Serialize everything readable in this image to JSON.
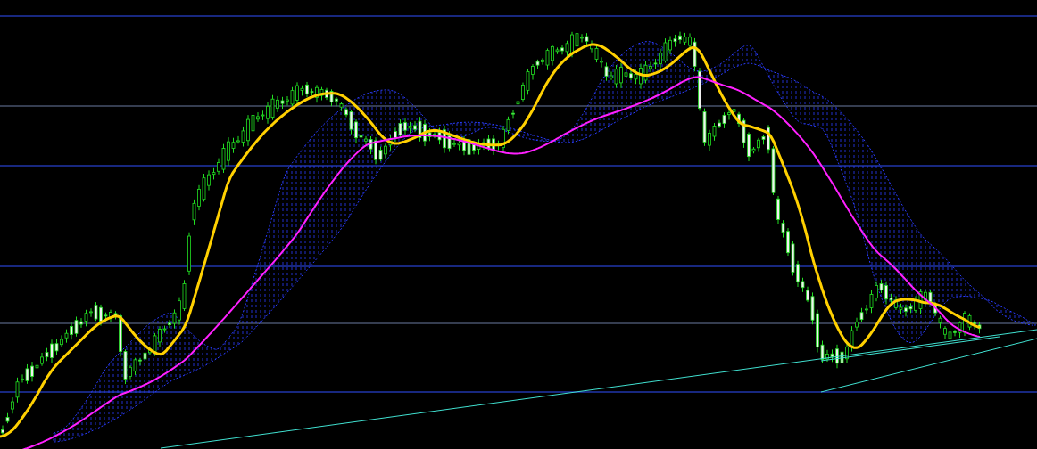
{
  "chart": {
    "kind": "candlestick",
    "indicators": [
      {
        "kind": "cloud",
        "color": "#2a3cff"
      },
      {
        "kind": "moving_average",
        "color": "#ffd000"
      },
      {
        "kind": "moving_average",
        "color": "#ff20ff"
      }
    ]
  }
}
